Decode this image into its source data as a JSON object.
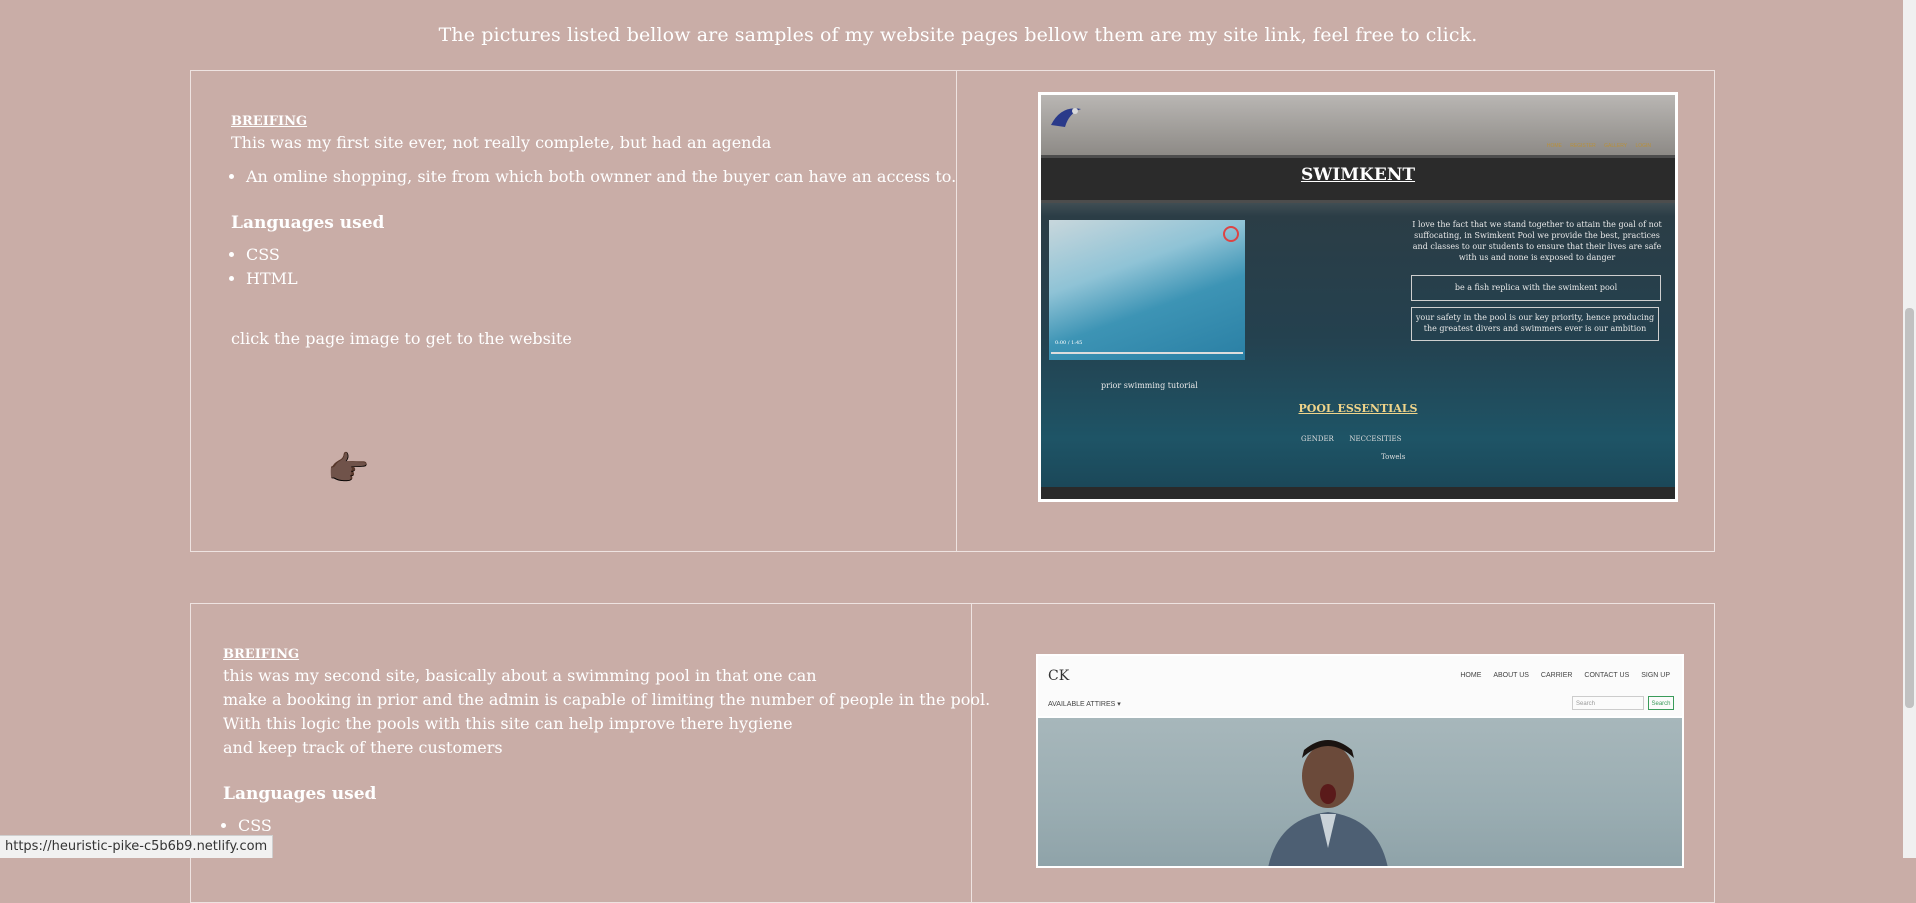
{
  "intro": "The pictures listed bellow are samples of my website pages bellow them are my site link, feel free to click.",
  "projects": [
    {
      "briefing_label": "BREIFING",
      "description_lines": [
        "This was my first site ever, not really complete, but had an agenda"
      ],
      "bullets": [
        "An omline shopping, site from which both ownner and the buyer can have an access to."
      ],
      "languages_heading": "Languages used",
      "languages": [
        "CSS",
        "HTML"
      ],
      "click_hint": "click the page image to get to the website",
      "preview": {
        "nav_links": [
          "HOME",
          "REGISTER",
          "GALLERY",
          "LOGIN"
        ],
        "title": "SWIMKENT",
        "quote": "I love the fact that we stand together to attain the goal of not suffocating, in Swimkent Pool we provide the best, practices and classes to our students to ensure that their lives are safe with us and none is exposed to danger",
        "box1": "be a fish replica with the swimkent pool",
        "box2": "your safety in the pool is our key priority, hence producing the greatest divers and swimmers ever is our ambition",
        "video_time": "0:00 / 1:45",
        "video_caption": "prior swimming tutorial",
        "section_title": "POOL ESSENTIALS",
        "table_headers": [
          "GENDER",
          "NECCESITIES"
        ],
        "table_cell": "Towels"
      }
    },
    {
      "briefing_label": "BREIFING",
      "description_lines": [
        "this was my second site, basically about a swimming pool in that one can",
        "make a booking in prior and the admin is capable of limiting the number of people in the pool.",
        "With this logic the pools with this site can help improve there hygiene",
        "and keep track of there customers"
      ],
      "languages_heading": "Languages used",
      "languages": [
        "CSS"
      ],
      "preview": {
        "logo": "CK",
        "nav_links": [
          "HOME",
          "ABOUT US",
          "CARRIER",
          "CONTACT US",
          "SIGN UP"
        ],
        "dropdown": "AVAILABLE ATTIRES",
        "search_placeholder": "Search",
        "search_button": "Search"
      }
    }
  ],
  "status_url": "https://heuristic-pike-c5b6b9.netlify.com",
  "colors": {
    "background": "#c9ada7",
    "text": "#ffffff",
    "border": "#eee3e1"
  },
  "icons": {
    "pointer": "backhand-index-pointing-right-icon"
  }
}
